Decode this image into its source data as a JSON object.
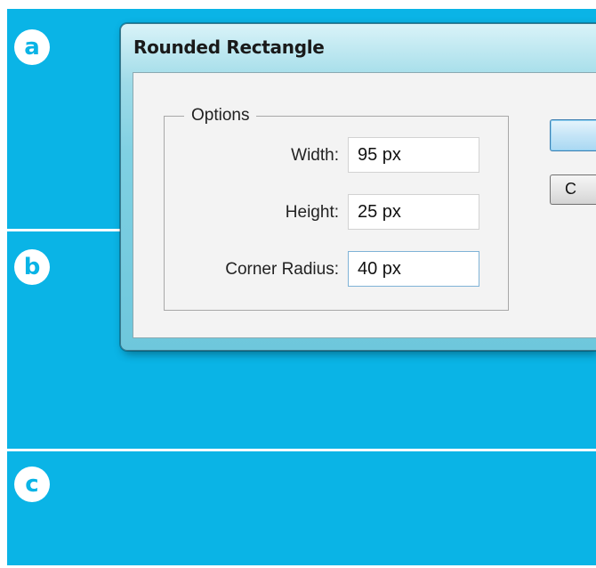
{
  "panels": {
    "a_label": "a",
    "b_label": "b",
    "c_label": "c"
  },
  "dialog": {
    "title": "Rounded Rectangle",
    "options_group": "Options",
    "fields": {
      "width_label": "Width:",
      "width_value": "95 px",
      "height_label": "Height:",
      "height_value": "25 px",
      "radius_label": "Corner Radius:",
      "radius_value": "40 px"
    },
    "buttons": {
      "ok_label": "",
      "cancel_label": "C"
    }
  },
  "colors": {
    "background": "#0ab4e6",
    "label_circle": "#ffffff"
  }
}
